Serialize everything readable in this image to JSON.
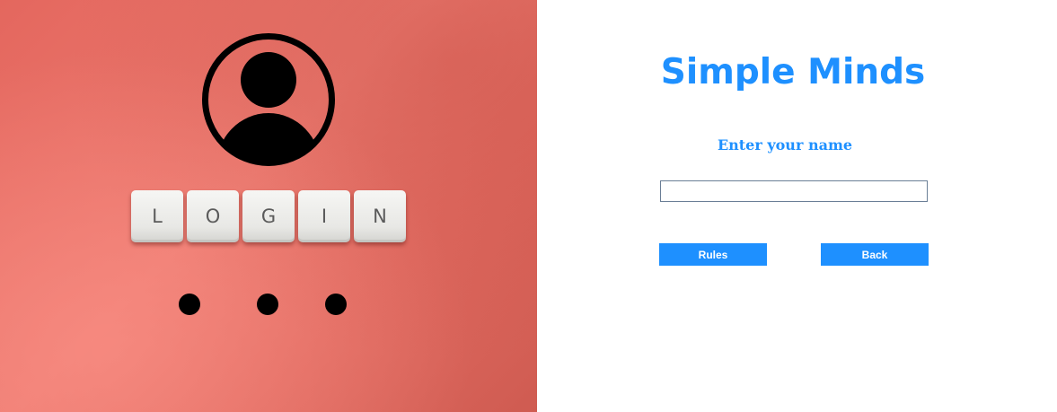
{
  "hero": {
    "tiles": [
      "L",
      "O",
      "G",
      "I",
      "N"
    ],
    "avatar_icon": "user-circle-icon",
    "dots_icon": "password-dots-icon"
  },
  "form": {
    "title": "Simple Minds",
    "prompt": "Enter your name",
    "name_value": "",
    "name_placeholder": ""
  },
  "buttons": {
    "rules_label": "Rules",
    "back_label": "Back"
  },
  "colors": {
    "accent": "#1e90ff",
    "hero_background": "#e4675e"
  }
}
